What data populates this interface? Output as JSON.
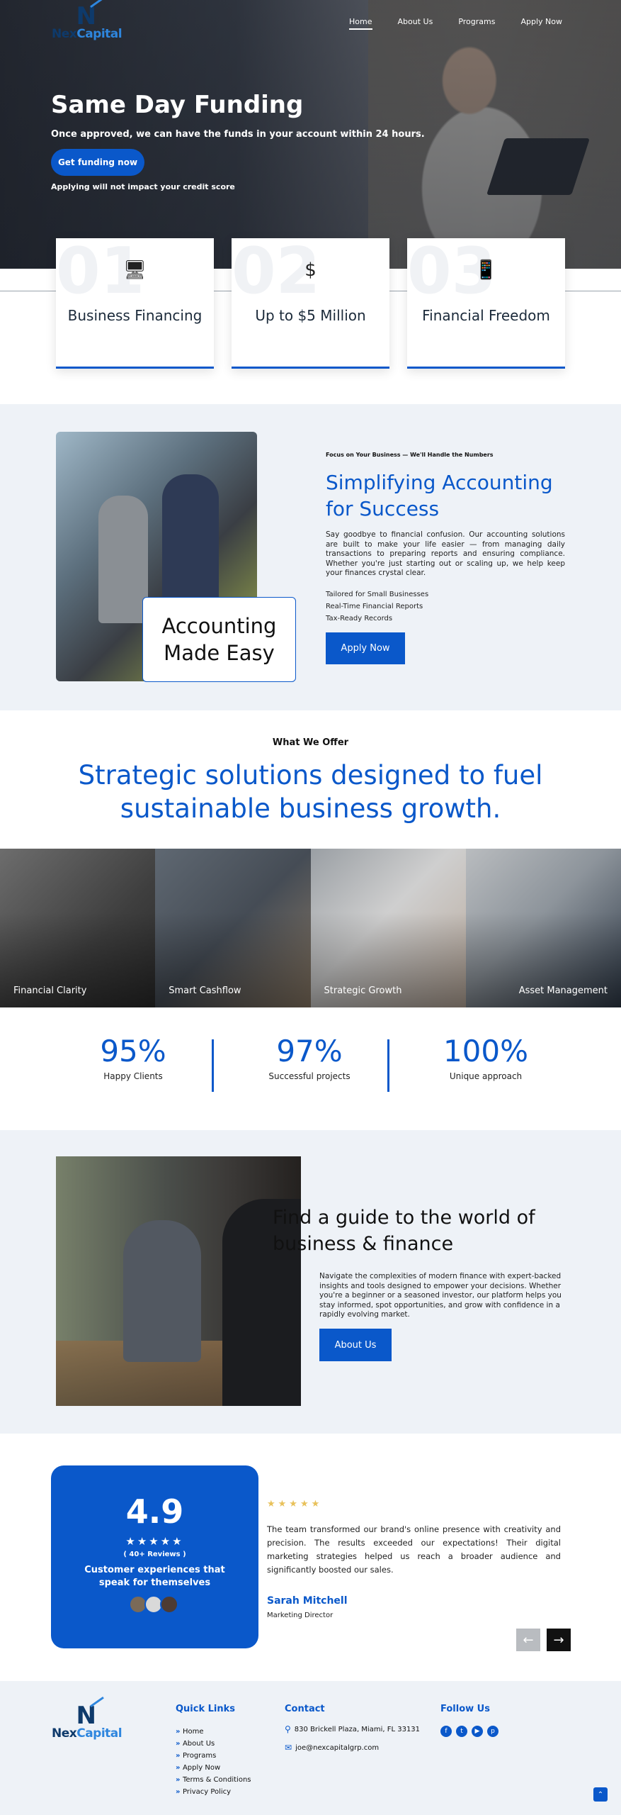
{
  "brand": {
    "name_a": "Nex",
    "name_b": "Capital"
  },
  "nav": {
    "items": [
      "Home",
      "About Us",
      "Programs",
      "Apply Now"
    ]
  },
  "hero": {
    "title": "Same Day Funding",
    "subtitle": "Once approved, we can have the funds in your account within 24 hours.",
    "cta": "Get funding now",
    "note": "Applying will not impact your credit score"
  },
  "features": [
    {
      "ghost": "01",
      "icon": "computer-money-icon",
      "glyph": "🖥",
      "title": "Business Financing"
    },
    {
      "ghost": "02",
      "icon": "dollar-icon",
      "glyph": "$",
      "title": "Up to $5 Million"
    },
    {
      "ghost": "03",
      "icon": "phone-dollar-icon",
      "glyph": "📱",
      "title": "Financial Freedom"
    }
  ],
  "accounting": {
    "overlay": "Accounting Made Easy",
    "kicker": "Focus on Your Business — We'll Handle the Numbers",
    "title": "Simplifying Accounting for Success",
    "body": "Say goodbye to financial confusion. Our accounting solutions are built to make your life easier — from managing daily transactions to preparing reports and ensuring compliance. Whether you're just starting out or scaling up, we help keep your finances crystal clear.",
    "list": [
      "Tailored for Small Businesses",
      "Real-Time Financial Reports",
      "Tax-Ready Records"
    ],
    "button": "Apply Now"
  },
  "offer": {
    "kicker": "What We Offer",
    "title": "Strategic solutions designed to fuel sustainable business growth.",
    "tiles": [
      "Financial Clarity",
      "Smart Cashflow",
      "Strategic Growth",
      "Asset Management"
    ]
  },
  "stats": [
    {
      "value": "95%",
      "label": "Happy Clients"
    },
    {
      "value": "97%",
      "label": "Successful projects"
    },
    {
      "value": "100%",
      "label": "Unique approach"
    }
  ],
  "guide": {
    "title": "Find a guide to the world of business & finance",
    "body": "Navigate the complexities of modern finance with expert-backed insights and tools designed to empower your decisions. Whether you're a beginner or a seasoned investor, our platform helps you stay informed, spot opportunities, and grow with confidence in a rapidly evolving market.",
    "button": "About Us"
  },
  "reviews": {
    "score": "4.9",
    "stars": "★★★★★",
    "count": "( 40+ Reviews )",
    "tagline": "Customer experiences that speak for themselves",
    "quote": "The team transformed our brand's online presence with creativity and precision. The results exceeded our expectations! Their digital marketing strategies helped us reach a broader audience and significantly boosted our sales.",
    "author": "Sarah Mitchell",
    "role": "Marketing Director",
    "prev": "←",
    "next": "→"
  },
  "footer": {
    "quick_title": "Quick Links",
    "links": [
      "Home",
      "About Us",
      "Programs",
      "Apply Now",
      "Terms & Conditions",
      "Privacy Policy"
    ],
    "contact_title": "Contact",
    "address": "830 Brickell Plaza, Miami, FL 33131",
    "email": "joe@nexcapitalgrp.com",
    "follow_title": "Follow Us",
    "social": [
      "f",
      "t",
      "▶",
      "p"
    ],
    "to_top": "⌃"
  },
  "colors": {
    "accent": "#0a58ca",
    "panel": "#eef2f7",
    "star": "#e8c15a"
  }
}
